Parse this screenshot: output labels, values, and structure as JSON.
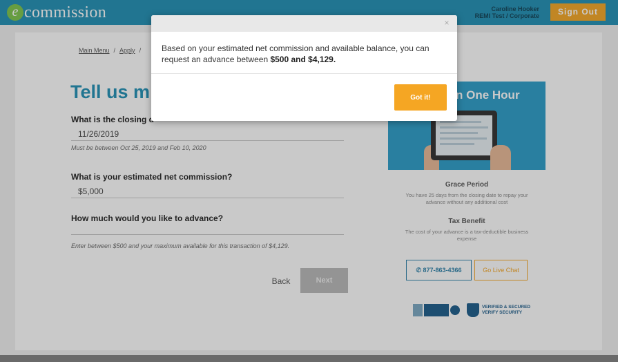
{
  "header": {
    "logo_e": "e",
    "logo_text": "commission",
    "user_name": "Caroline Hooker",
    "user_org": "REMI Test / Corporate",
    "signout_label": "Sign Out"
  },
  "breadcrumb": {
    "items": [
      "Main Menu",
      "Apply"
    ]
  },
  "form": {
    "page_title": "Tell us m",
    "closing_label": "What is the closing d",
    "closing_value": "11/26/2019",
    "closing_help": "Must be between Oct 25, 2019 and Feb 10, 2020",
    "commission_label": "What is your estimated net commission?",
    "commission_value": "$5,000",
    "advance_label": "How much would you like to advance?",
    "advance_help": "Enter between $500 and your maximum available for this transaction of $4,129.",
    "back_label": "Back",
    "next_label": "Next"
  },
  "sidebar": {
    "promo_title": "n One Hour",
    "benefit_1_title": "Grace Period",
    "benefit_1_text": "You have 25 days from the closing date to repay your advance without any additional cost",
    "benefit_2_title": "Tax Benefit",
    "benefit_2_text": "The cost of your advance is a tax-deductible business expense",
    "phone_label": "877-863-4366",
    "chat_label": "Go Live Chat",
    "badge_text_1": "VERIFIED & SECURED",
    "badge_text_2": "VERIFY SECURITY"
  },
  "modal": {
    "close_glyph": "×",
    "message_prefix": "Based on your estimated net commission and available balance, you can request an advance between ",
    "message_bold": "$500 and $4,129.",
    "button_label": "Got it!"
  },
  "colors": {
    "brand_blue": "#1f8fb4",
    "accent_orange": "#f5a623"
  }
}
